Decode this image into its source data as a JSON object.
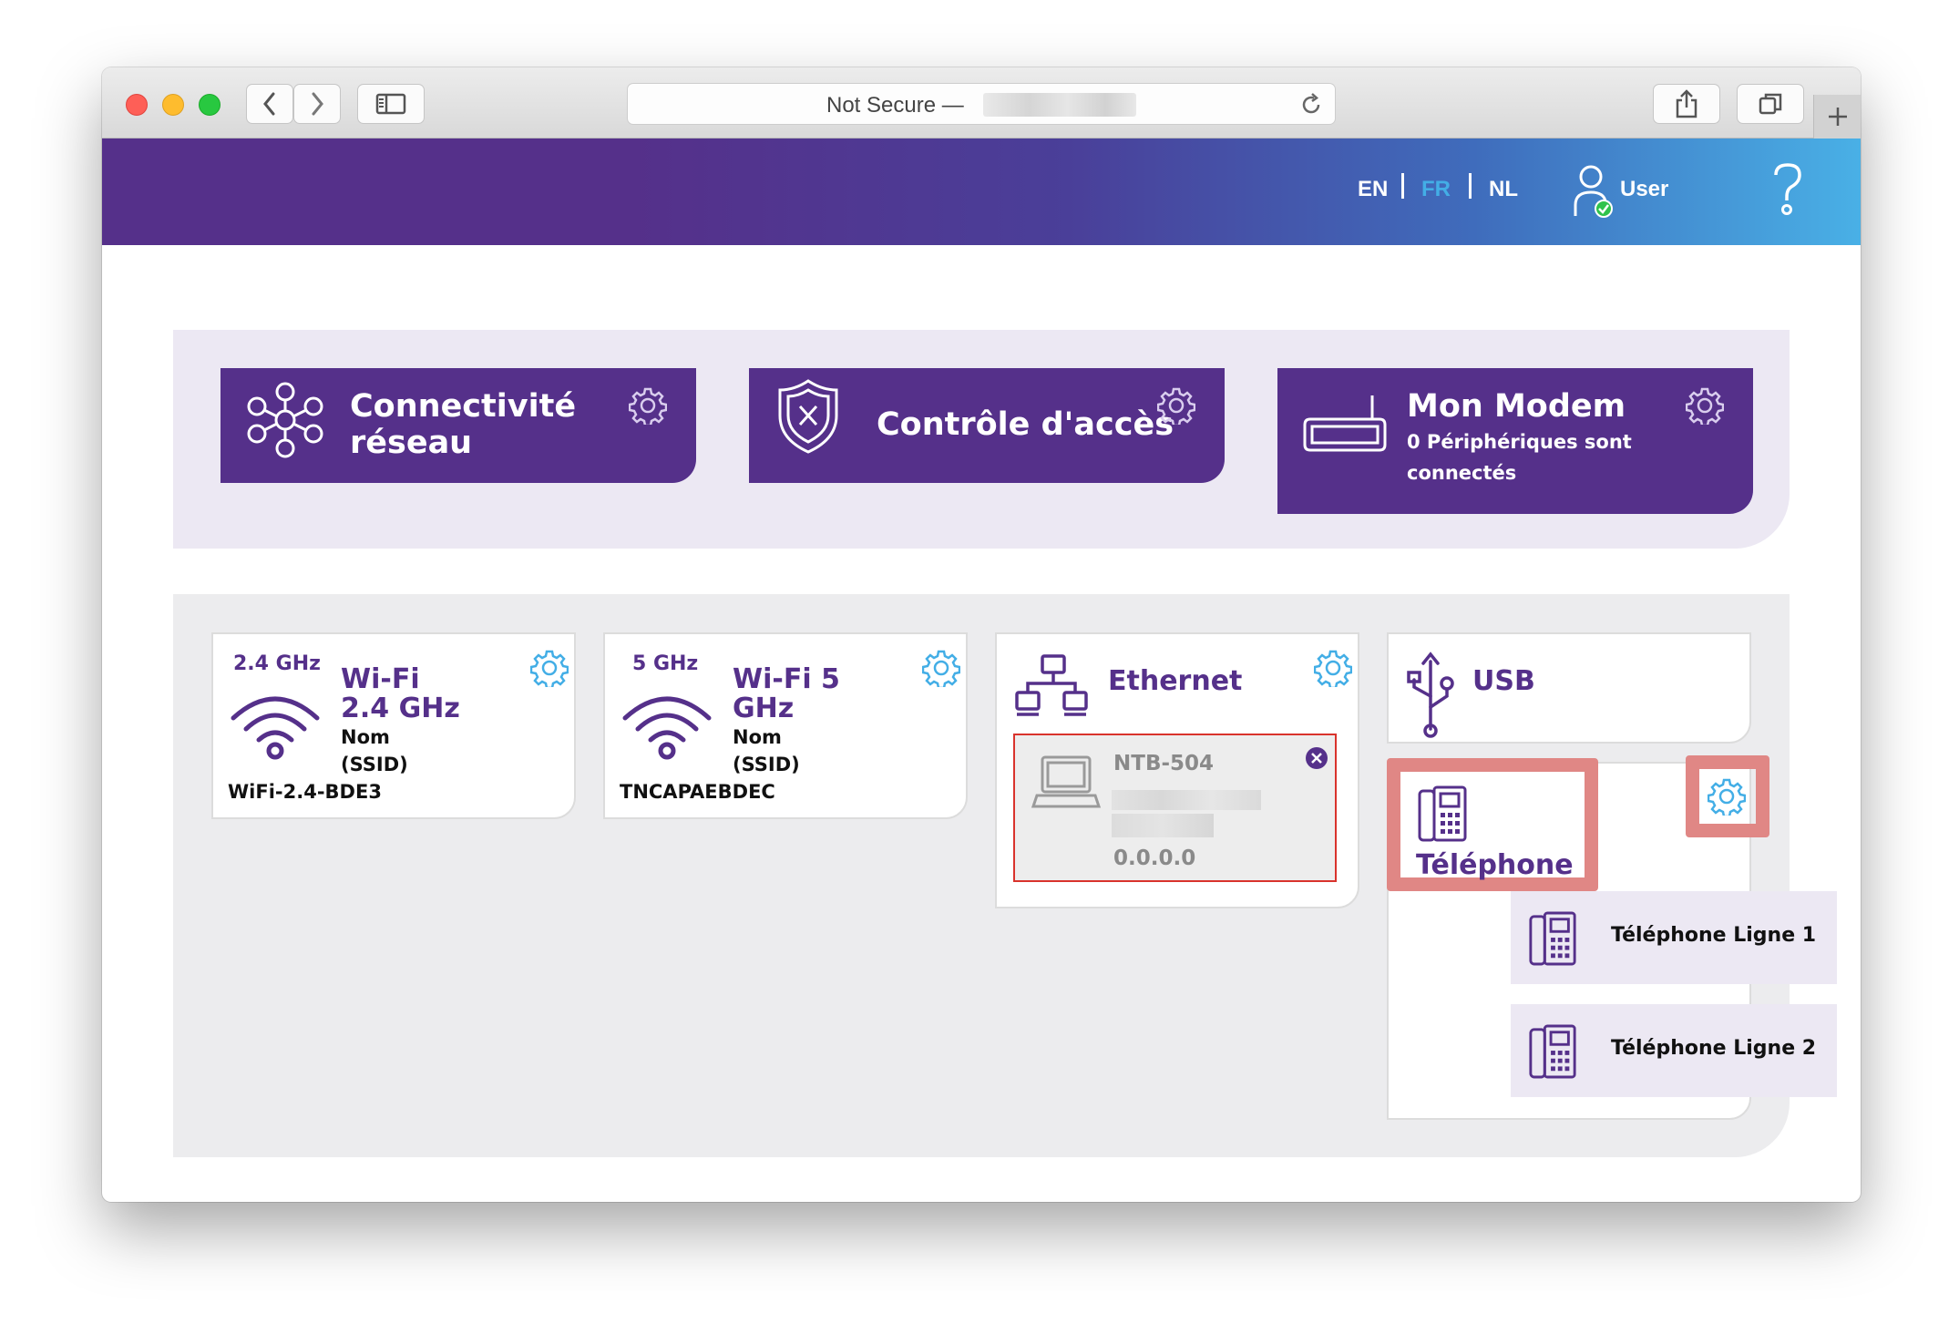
{
  "browser": {
    "url_prefix": "Not Secure —",
    "buttons": {
      "back": "chevron-left-icon",
      "forward": "chevron-right-icon",
      "sidebar": "sidebar-icon",
      "reload": "reload-icon",
      "share": "share-icon",
      "tabs": "tabs-icon",
      "new_tab": "plus-icon"
    }
  },
  "header": {
    "languages": [
      "EN",
      "FR",
      "NL"
    ],
    "active_language": "FR",
    "user_label": "User",
    "help_icon": "question-mark-icon"
  },
  "tiles": [
    {
      "title_line1": "Connectivité",
      "title_line2": "réseau",
      "icon": "network-icon"
    },
    {
      "title": "Contrôle d'accès",
      "icon": "shield-icon"
    },
    {
      "title": "Mon Modem",
      "sub_line1": "0 Périphériques sont",
      "sub_line2": "connectés",
      "icon": "modem-icon"
    }
  ],
  "cards": {
    "wifi24": {
      "freq": "2.4 GHz",
      "title_line1": "Wi-Fi",
      "title_line2": "2.4 GHz",
      "label_line1": "Nom",
      "label_line2": "(SSID)",
      "ssid": "WiFi-2.4-BDE3"
    },
    "wifi5": {
      "freq": "5 GHz",
      "title_line1": "Wi-Fi 5",
      "title_line2": "GHz",
      "label_line1": "Nom",
      "label_line2": "(SSID)",
      "ssid": "TNCAPAEBDEC"
    },
    "ethernet": {
      "title": "Ethernet",
      "device_name": "NTB-504",
      "device_ip": "0.0.0.0"
    },
    "usb": {
      "title": "USB"
    },
    "telephone": {
      "title": "Téléphone",
      "lines": [
        "Téléphone Ligne 1",
        "Téléphone Ligne 2"
      ]
    }
  },
  "colors": {
    "brand_purple": "#55308a",
    "accent_blue": "#43aee6",
    "highlight": "#e08785"
  }
}
